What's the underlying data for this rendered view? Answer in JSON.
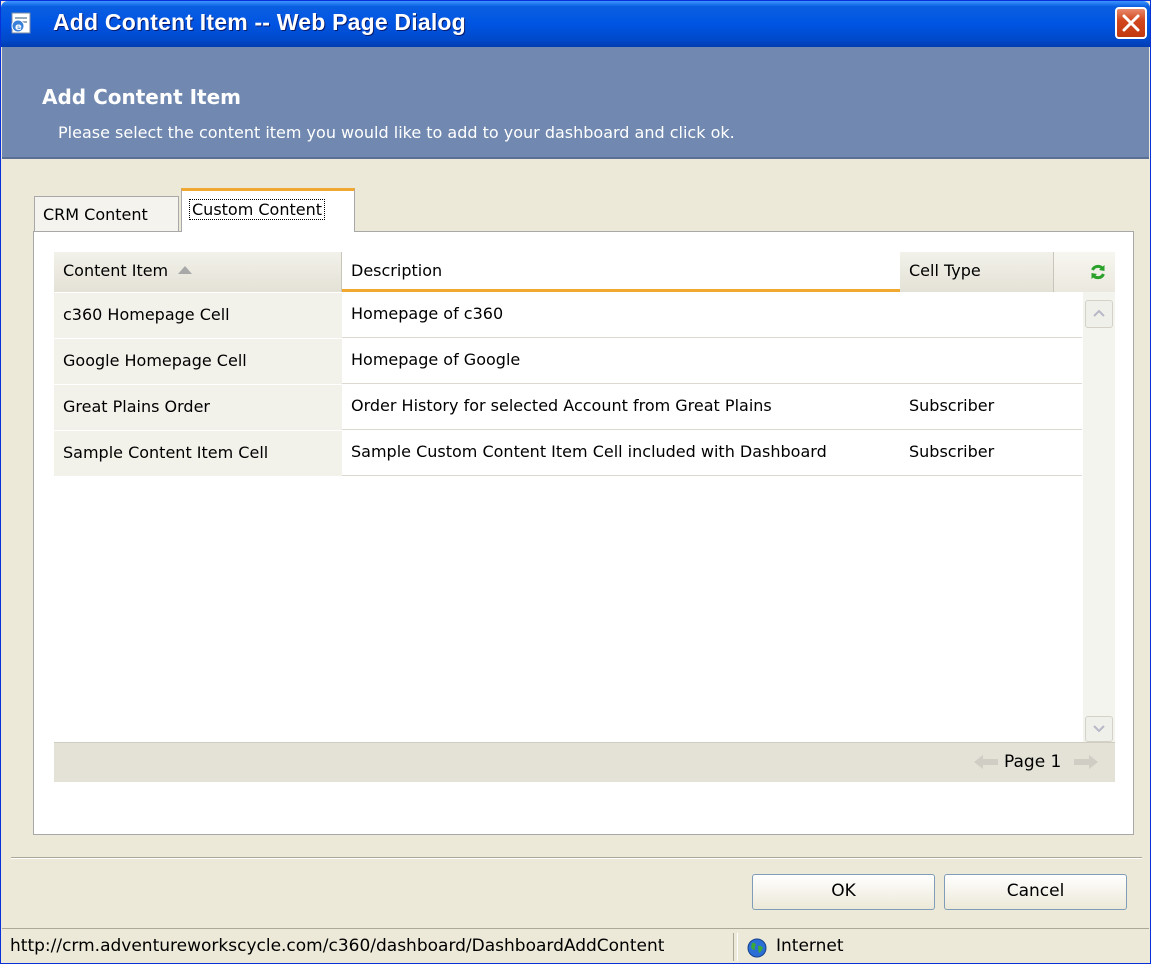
{
  "window": {
    "title": "Add Content Item -- Web Page Dialog"
  },
  "header": {
    "title": "Add Content Item",
    "subtitle": "Please select the content item you would like to add to your dashboard and click ok."
  },
  "tabs": [
    {
      "label": "CRM Content",
      "selected": false
    },
    {
      "label": "Custom Content",
      "selected": true
    }
  ],
  "grid": {
    "columns": [
      "Content Item",
      "Description",
      "Cell Type"
    ],
    "sort_column": "Content Item",
    "sort_direction": "ascending",
    "rows": [
      {
        "item": "c360 Homepage Cell",
        "description": "Homepage of c360",
        "type": ""
      },
      {
        "item": "Google Homepage Cell",
        "description": "Homepage of Google",
        "type": ""
      },
      {
        "item": "Great Plains Order",
        "description": "Order History for selected Account from Great Plains",
        "type": "Subscriber"
      },
      {
        "item": "Sample Content Item Cell",
        "description": "Sample Custom Content Item Cell included with Dashboard",
        "type": "Subscriber"
      }
    ],
    "pager_label": "Page 1"
  },
  "buttons": {
    "ok": "OK",
    "cancel": "Cancel"
  },
  "statusbar": {
    "url": "http://crm.adventureworkscycle.com/c360/dashboard/DashboardAddContent",
    "zone": "Internet"
  },
  "colors": {
    "titlebar": "#0054e3",
    "header_band": "#7189b0",
    "accent": "#f0a830",
    "refresh_icon": "#2aa12a"
  },
  "icons": [
    "ie-page-icon",
    "close-icon",
    "sort-ascending-icon",
    "refresh-icon",
    "scroll-up-icon",
    "scroll-down-icon",
    "prev-page-icon",
    "next-page-icon",
    "globe-icon"
  ]
}
